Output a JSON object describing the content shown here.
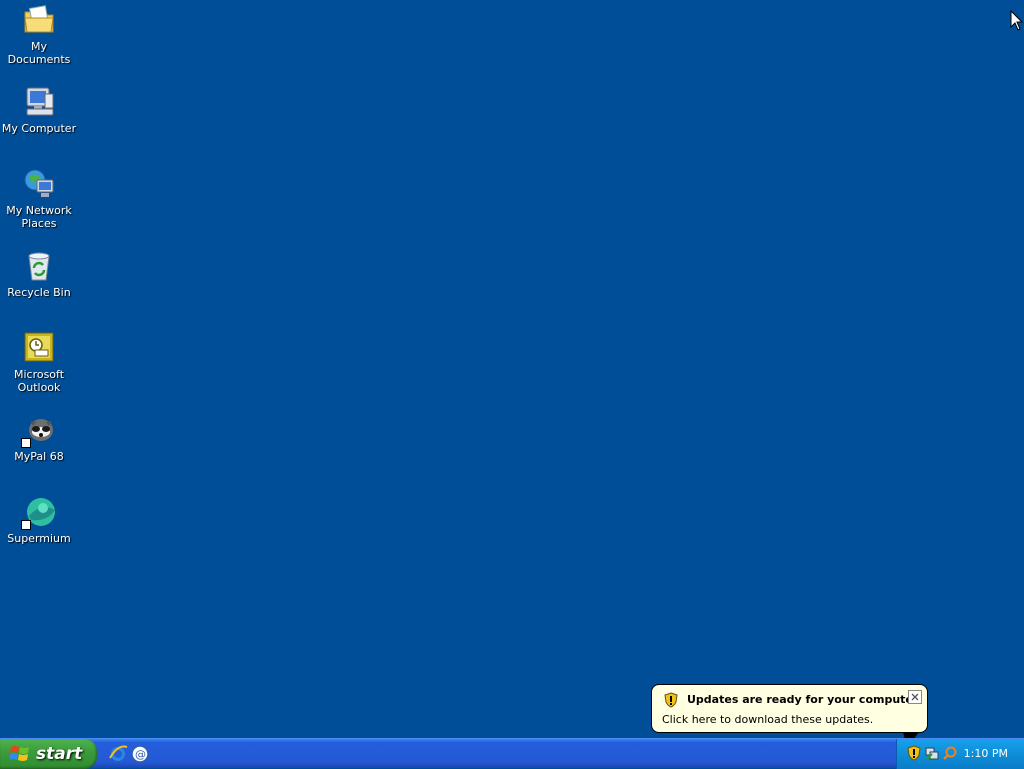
{
  "desktop": {
    "icons": [
      {
        "label": "My Documents",
        "icon": "folder-documents-icon"
      },
      {
        "label": "My Computer",
        "icon": "computer-icon"
      },
      {
        "label": "My Network Places",
        "icon": "network-places-icon"
      },
      {
        "label": "Recycle Bin",
        "icon": "recycle-bin-icon"
      },
      {
        "label": "Microsoft Outlook",
        "icon": "outlook-icon"
      },
      {
        "label": "MyPal 68",
        "icon": "mypal-browser-icon"
      },
      {
        "label": "Supermium",
        "icon": "supermium-browser-icon"
      }
    ],
    "background_color": "#004E98"
  },
  "taskbar": {
    "start_label": "start",
    "quick_launch": [
      "internet-explorer-icon",
      "outlook-express-icon"
    ],
    "tray_icons": [
      "windows-update-shield-icon",
      "network-status-icon",
      "search-icon"
    ],
    "clock": "1:10 PM"
  },
  "balloon": {
    "title": "Updates are ready for your computer",
    "text": "Click here to download these updates.",
    "icon": "security-shield-icon"
  }
}
